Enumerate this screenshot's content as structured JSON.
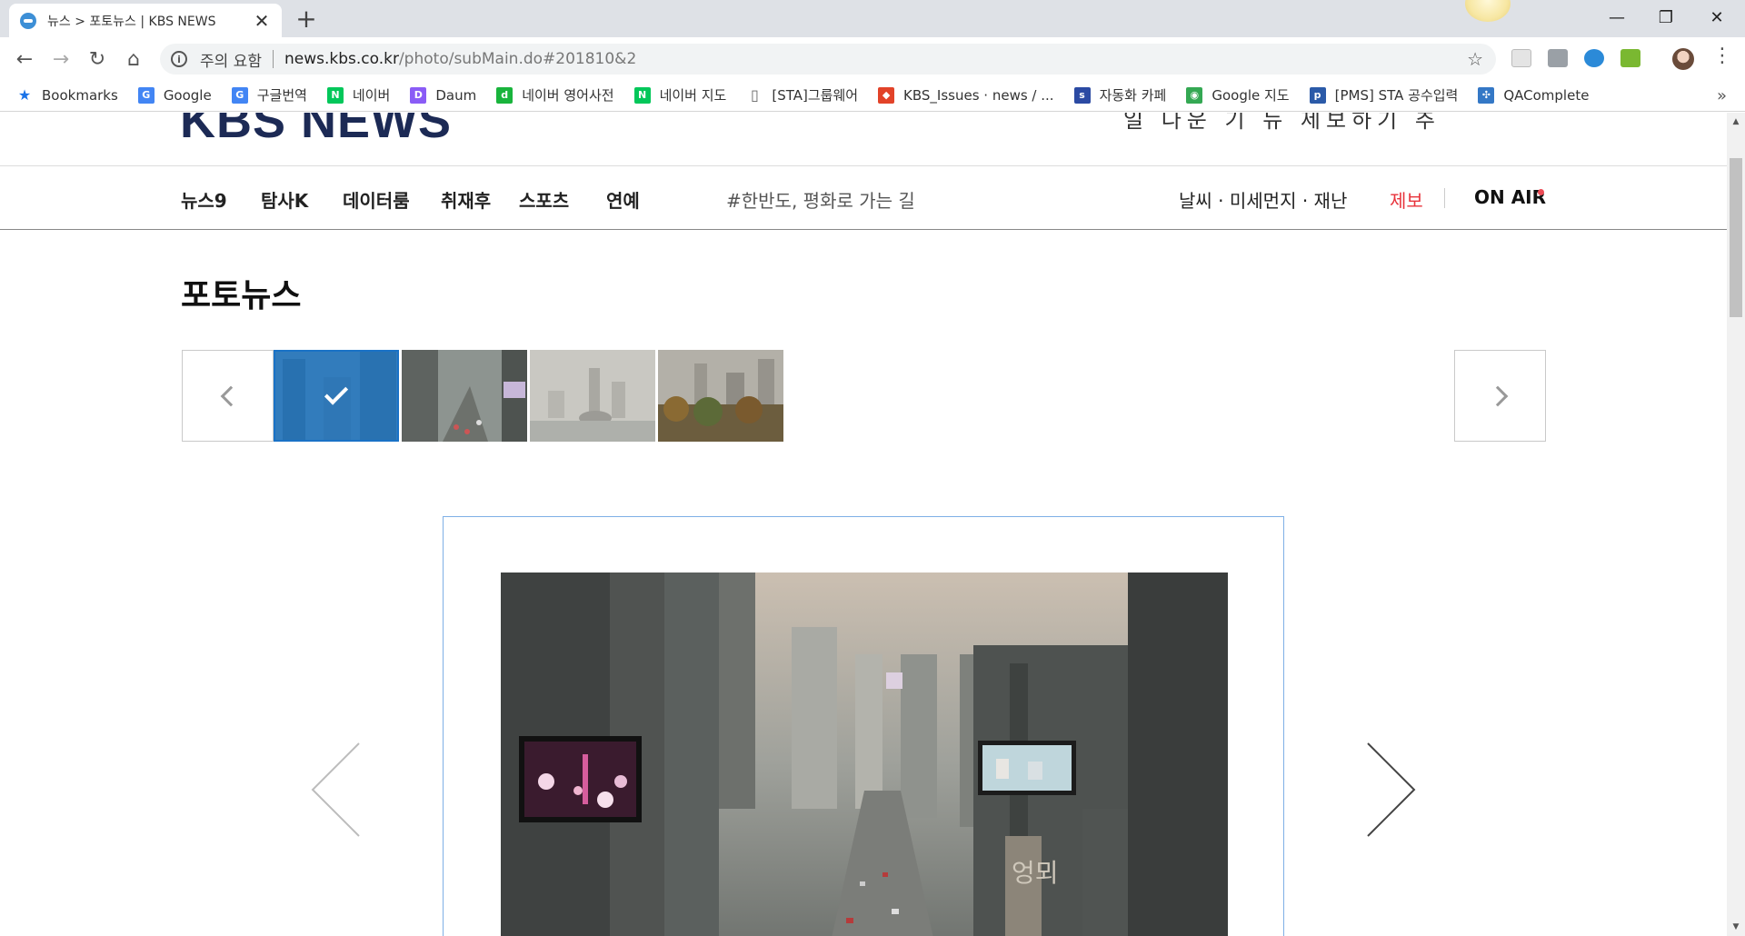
{
  "browser": {
    "tab_title": "뉴스 > 포토뉴스 | KBS NEWS",
    "security_label": "주의 요함",
    "url_host": "news.kbs.co.kr",
    "url_path": "/photo/subMain.do#201810&2",
    "bookmarks": [
      {
        "label": "Bookmarks",
        "icon": "star-icon",
        "color": "#1a73e8"
      },
      {
        "label": "Google",
        "icon": "google-icon",
        "color": "#4285f4"
      },
      {
        "label": "구글번역",
        "icon": "translate-icon",
        "color": "#4285f4"
      },
      {
        "label": "네이버",
        "icon": "naver-icon",
        "color": "#03c75a"
      },
      {
        "label": "Daum",
        "icon": "daum-icon",
        "color": "#8a5cf6"
      },
      {
        "label": "네이버 영어사전",
        "icon": "dict-icon",
        "color": "#19b43c"
      },
      {
        "label": "네이버 지도",
        "icon": "naver-icon",
        "color": "#03c75a"
      },
      {
        "label": "[STA]그룹웨어",
        "icon": "page-icon",
        "color": "#666666"
      },
      {
        "label": "KBS_Issues · news / ...",
        "icon": "gitlab-icon",
        "color": "#e24329"
      },
      {
        "label": "자동화 카페",
        "icon": "sta-icon",
        "color": "#2b4aa3"
      },
      {
        "label": "Google 지도",
        "icon": "maps-icon",
        "color": "#34a853"
      },
      {
        "label": "[PMS] STA 공수입력",
        "icon": "pms-icon",
        "color": "#2b5aa8"
      },
      {
        "label": "QAComplete",
        "icon": "qa-icon",
        "color": "#3478c6"
      }
    ],
    "bookmarks_more": "»"
  },
  "site": {
    "logo_text": "KBS NEWS",
    "top_links_text": "일 다운 기 뉴 제보하기 추",
    "gnb": [
      {
        "label": "뉴스9",
        "name": "gnb-news9"
      },
      {
        "label": "탐사K",
        "name": "gnb-tamsak"
      },
      {
        "label": "데이터룸",
        "name": "gnb-dataroom"
      },
      {
        "label": "취재후",
        "name": "gnb-after-report"
      },
      {
        "label": "스포츠",
        "name": "gnb-sports"
      },
      {
        "label": "연예",
        "name": "gnb-entertainment"
      }
    ],
    "hashtag": "#한반도, 평화로 가는 길",
    "weather_link": "날씨 · 미세먼지 · 재난",
    "tip_link": "제보",
    "onair_link": "ON AIR",
    "accent_red": "#e8333b",
    "selected_blue": "#1a72c6"
  },
  "photo_news": {
    "page_title": "포토뉴스",
    "thumbnails": [
      {
        "name": "thumb-1",
        "selected": true
      },
      {
        "name": "thumb-2",
        "selected": false
      },
      {
        "name": "thumb-3",
        "selected": false
      },
      {
        "name": "thumb-4",
        "selected": false
      }
    ],
    "billboard_text": "엉뫼"
  }
}
